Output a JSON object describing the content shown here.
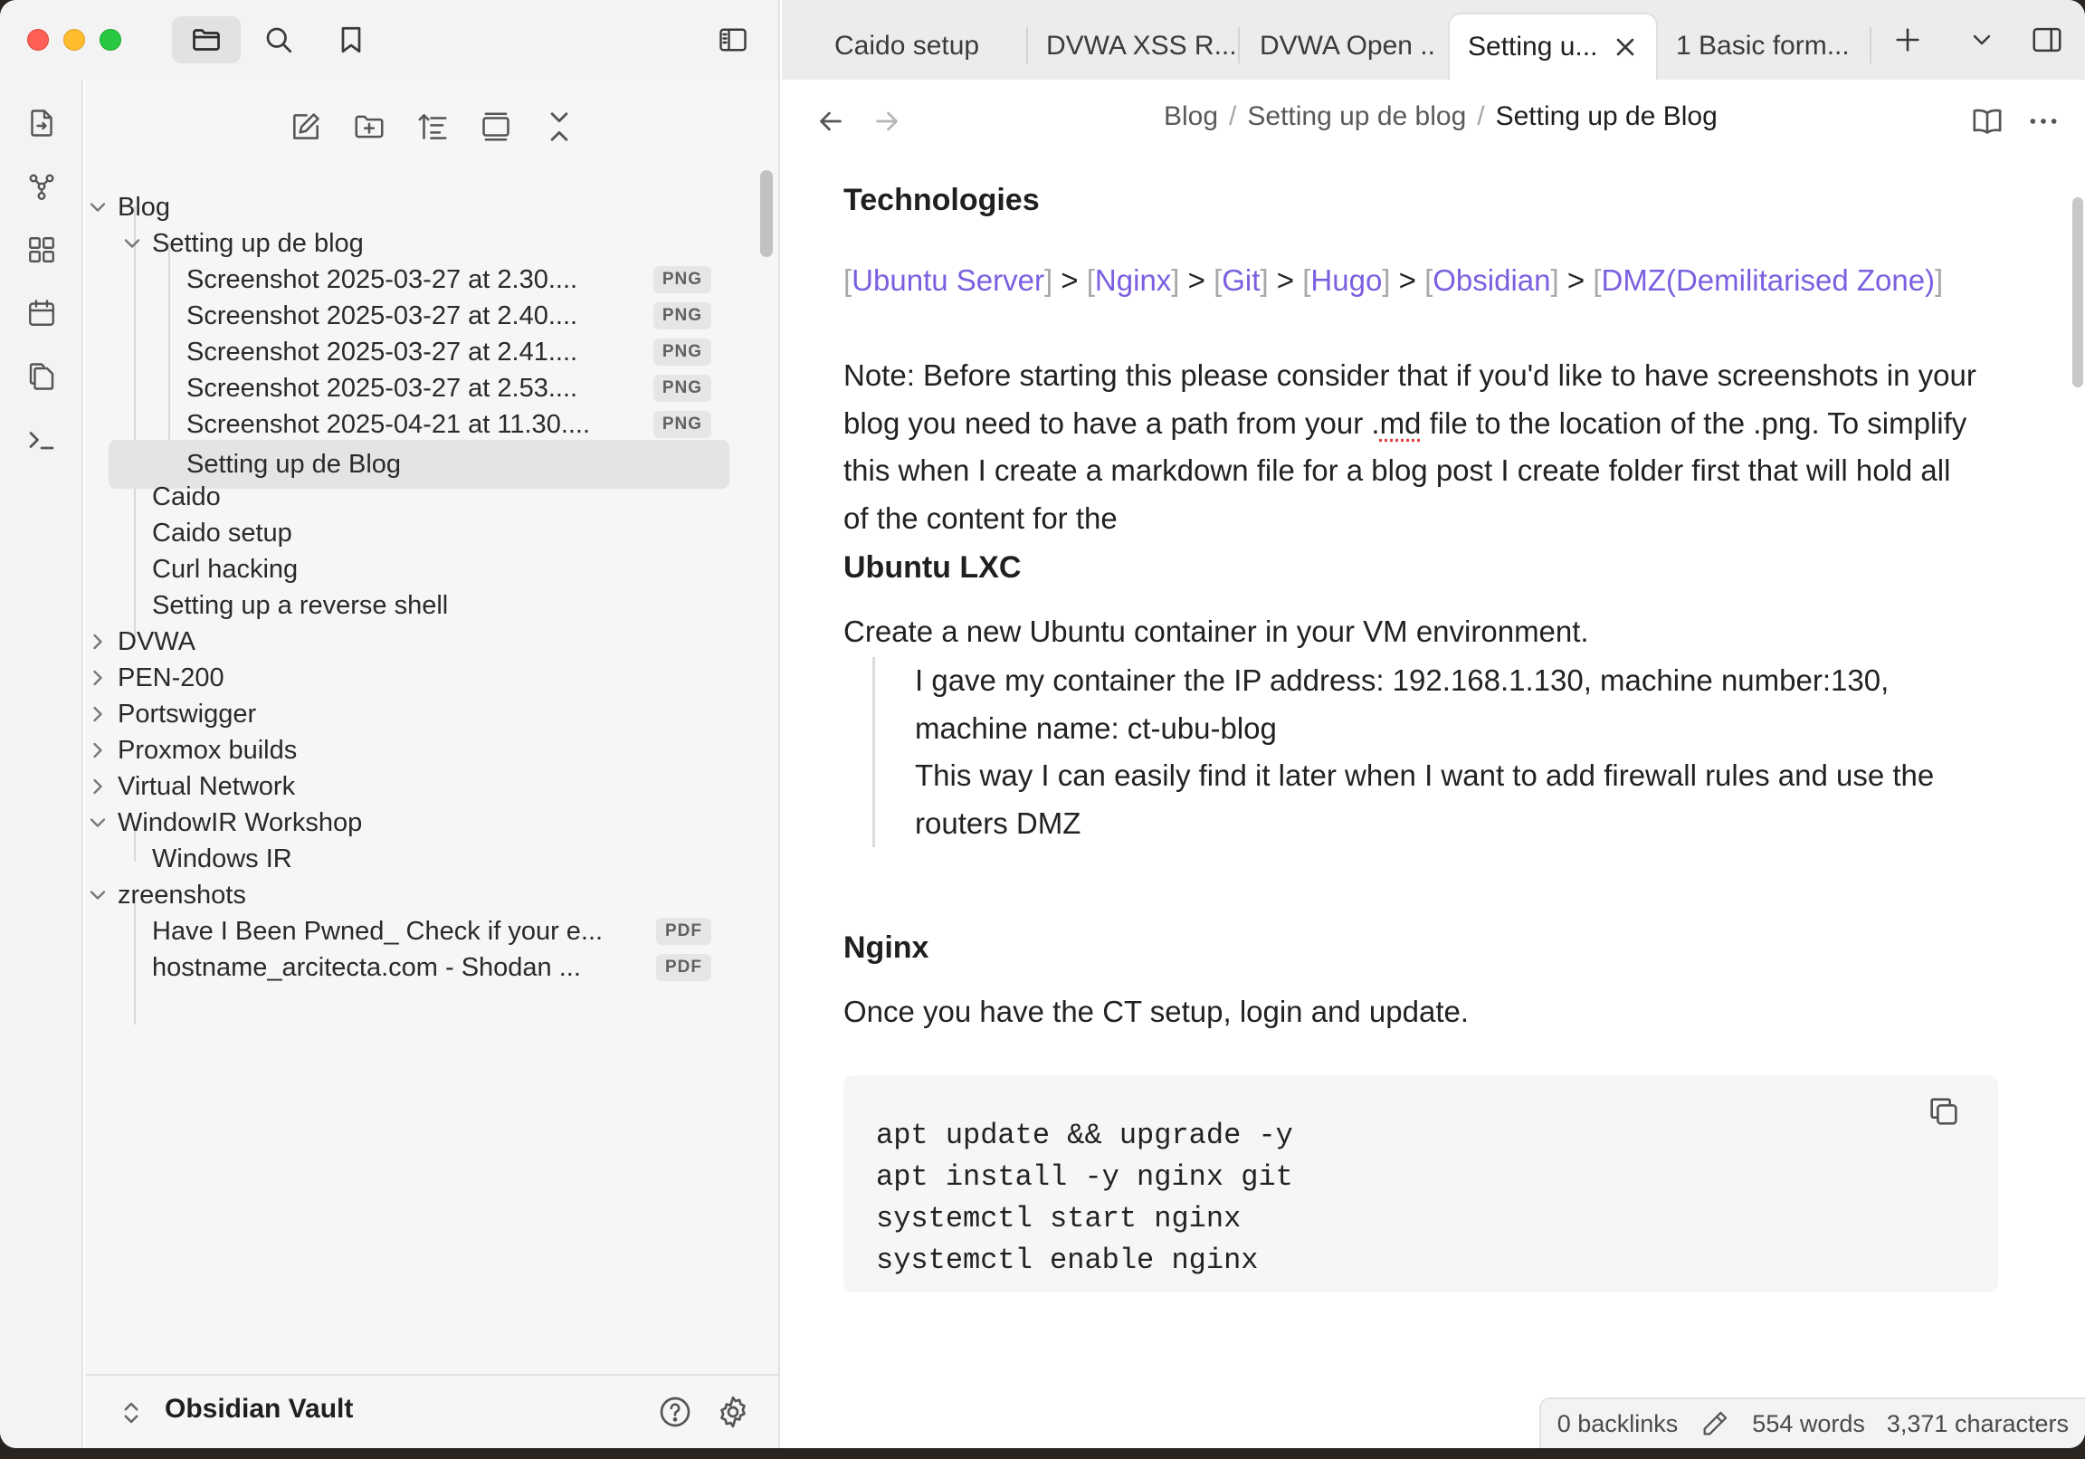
{
  "tabs": [
    {
      "label": "Caido setup"
    },
    {
      "label": "DVWA XSS R..."
    },
    {
      "label": "DVWA Open ..."
    },
    {
      "label": "Setting u..."
    },
    {
      "label": "1 Basic form..."
    }
  ],
  "active_tab_index": 3,
  "sidebar": {
    "tree": [
      {
        "label": "Blog",
        "type": "folder",
        "expanded": true,
        "depth": 0
      },
      {
        "label": "Setting up de blog",
        "type": "folder",
        "expanded": true,
        "depth": 1
      },
      {
        "label": "Screenshot 2025-03-27 at 2.30....",
        "type": "file",
        "badge": "PNG",
        "depth": 2
      },
      {
        "label": "Screenshot 2025-03-27 at 2.40....",
        "type": "file",
        "badge": "PNG",
        "depth": 2
      },
      {
        "label": "Screenshot 2025-03-27 at 2.41....",
        "type": "file",
        "badge": "PNG",
        "depth": 2
      },
      {
        "label": "Screenshot 2025-03-27 at 2.53....",
        "type": "file",
        "badge": "PNG",
        "depth": 2
      },
      {
        "label": "Screenshot 2025-04-21 at 11.30....",
        "type": "file",
        "badge": "PNG",
        "depth": 2
      },
      {
        "label": "Setting up de Blog",
        "type": "file",
        "selected": true,
        "depth": 2
      },
      {
        "label": "Caido",
        "type": "file",
        "depth": 1
      },
      {
        "label": "Caido setup",
        "type": "file",
        "depth": 1
      },
      {
        "label": "Curl hacking",
        "type": "file",
        "depth": 1
      },
      {
        "label": "Setting up a reverse shell",
        "type": "file",
        "depth": 1
      },
      {
        "label": "DVWA",
        "type": "folder",
        "expanded": false,
        "depth": 0
      },
      {
        "label": "PEN-200",
        "type": "folder",
        "expanded": false,
        "depth": 0
      },
      {
        "label": "Portswigger",
        "type": "folder",
        "expanded": false,
        "depth": 0
      },
      {
        "label": "Proxmox builds",
        "type": "folder",
        "expanded": false,
        "depth": 0
      },
      {
        "label": "Virtual Network",
        "type": "folder",
        "expanded": false,
        "depth": 0
      },
      {
        "label": "WindowIR Workshop",
        "type": "folder",
        "expanded": true,
        "depth": 0
      },
      {
        "label": "Windows IR",
        "type": "file",
        "depth": 1
      },
      {
        "label": "zreenshots",
        "type": "folder",
        "expanded": true,
        "depth": 0
      },
      {
        "label": "Have I Been Pwned_ Check if your e...",
        "type": "file",
        "badge": "PDF",
        "depth": 1
      },
      {
        "label": "hostname_arcitecta.com - Shodan ...",
        "type": "file",
        "badge": "PDF",
        "depth": 1
      }
    ],
    "vault_name": "Obsidian Vault"
  },
  "breadcrumbs": [
    "Blog",
    "Setting up de blog",
    "Setting up de Blog"
  ],
  "document": {
    "h_technologies": "Technologies",
    "tech_links": [
      "Ubuntu Server",
      "Nginx",
      "Git",
      "Hugo",
      "Obsidian",
      "DMZ(Demilitarised Zone)"
    ],
    "note_part1": "Note: Before starting this please consider that if you'd like to have screenshots in your blog you need to have a path from your .",
    "note_misspelled": "md",
    "note_part2": " file to the location of the .png. To simplify this when I create a markdown file for a blog post I create folder first that will hold all of the content for the",
    "h_ubuntu": "Ubuntu LXC",
    "ubuntu_text": "Create a new Ubuntu container in your VM environment.",
    "quote_line1": "I gave my container the IP address: 192.168.1.130, machine number:130, machine name: ct-ubu-blog",
    "quote_line2": "This way I can easily find it later when I want to add firewall rules and use the routers DMZ",
    "h_nginx": "Nginx",
    "nginx_text": "Once you have the CT setup, login and update.",
    "code_lines": [
      "apt update && upgrade -y",
      "apt install -y nginx git",
      "systemctl start nginx",
      "systemctl enable nginx"
    ]
  },
  "status_bar": {
    "backlinks": "0 backlinks",
    "words": "554 words",
    "characters": "3,371 characters"
  },
  "colors": {
    "link": "#7b5fe0",
    "close_red": "#fe5f57",
    "minimize_yellow": "#febc2e",
    "zoom_green": "#28c840"
  }
}
